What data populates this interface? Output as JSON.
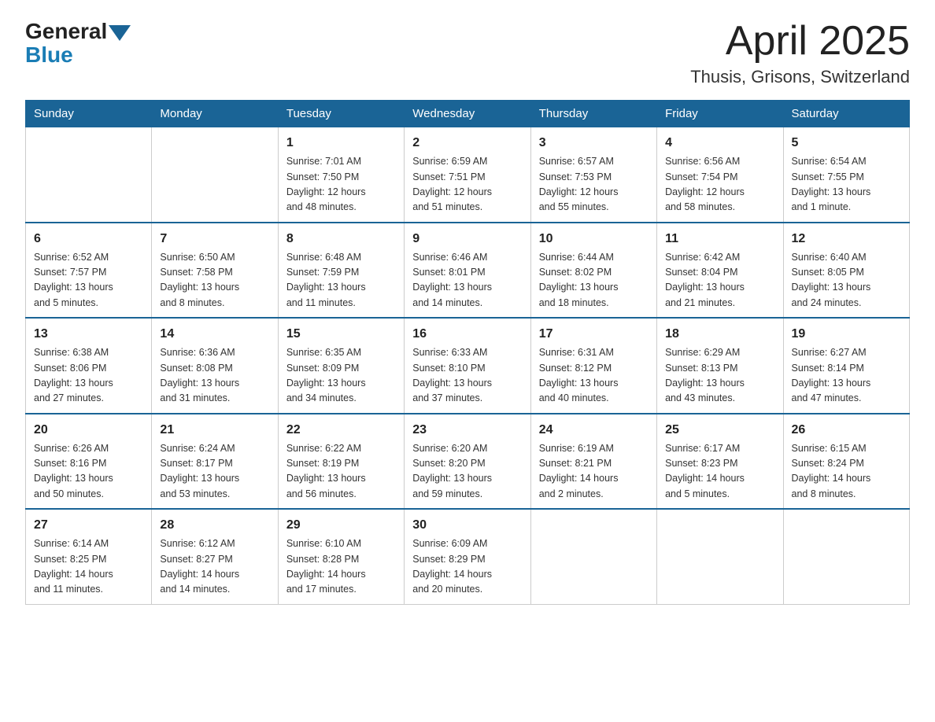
{
  "header": {
    "logo_general": "General",
    "logo_blue": "Blue",
    "month_title": "April 2025",
    "location": "Thusis, Grisons, Switzerland"
  },
  "weekdays": [
    "Sunday",
    "Monday",
    "Tuesday",
    "Wednesday",
    "Thursday",
    "Friday",
    "Saturday"
  ],
  "weeks": [
    [
      {
        "day": "",
        "info": ""
      },
      {
        "day": "",
        "info": ""
      },
      {
        "day": "1",
        "info": "Sunrise: 7:01 AM\nSunset: 7:50 PM\nDaylight: 12 hours\nand 48 minutes."
      },
      {
        "day": "2",
        "info": "Sunrise: 6:59 AM\nSunset: 7:51 PM\nDaylight: 12 hours\nand 51 minutes."
      },
      {
        "day": "3",
        "info": "Sunrise: 6:57 AM\nSunset: 7:53 PM\nDaylight: 12 hours\nand 55 minutes."
      },
      {
        "day": "4",
        "info": "Sunrise: 6:56 AM\nSunset: 7:54 PM\nDaylight: 12 hours\nand 58 minutes."
      },
      {
        "day": "5",
        "info": "Sunrise: 6:54 AM\nSunset: 7:55 PM\nDaylight: 13 hours\nand 1 minute."
      }
    ],
    [
      {
        "day": "6",
        "info": "Sunrise: 6:52 AM\nSunset: 7:57 PM\nDaylight: 13 hours\nand 5 minutes."
      },
      {
        "day": "7",
        "info": "Sunrise: 6:50 AM\nSunset: 7:58 PM\nDaylight: 13 hours\nand 8 minutes."
      },
      {
        "day": "8",
        "info": "Sunrise: 6:48 AM\nSunset: 7:59 PM\nDaylight: 13 hours\nand 11 minutes."
      },
      {
        "day": "9",
        "info": "Sunrise: 6:46 AM\nSunset: 8:01 PM\nDaylight: 13 hours\nand 14 minutes."
      },
      {
        "day": "10",
        "info": "Sunrise: 6:44 AM\nSunset: 8:02 PM\nDaylight: 13 hours\nand 18 minutes."
      },
      {
        "day": "11",
        "info": "Sunrise: 6:42 AM\nSunset: 8:04 PM\nDaylight: 13 hours\nand 21 minutes."
      },
      {
        "day": "12",
        "info": "Sunrise: 6:40 AM\nSunset: 8:05 PM\nDaylight: 13 hours\nand 24 minutes."
      }
    ],
    [
      {
        "day": "13",
        "info": "Sunrise: 6:38 AM\nSunset: 8:06 PM\nDaylight: 13 hours\nand 27 minutes."
      },
      {
        "day": "14",
        "info": "Sunrise: 6:36 AM\nSunset: 8:08 PM\nDaylight: 13 hours\nand 31 minutes."
      },
      {
        "day": "15",
        "info": "Sunrise: 6:35 AM\nSunset: 8:09 PM\nDaylight: 13 hours\nand 34 minutes."
      },
      {
        "day": "16",
        "info": "Sunrise: 6:33 AM\nSunset: 8:10 PM\nDaylight: 13 hours\nand 37 minutes."
      },
      {
        "day": "17",
        "info": "Sunrise: 6:31 AM\nSunset: 8:12 PM\nDaylight: 13 hours\nand 40 minutes."
      },
      {
        "day": "18",
        "info": "Sunrise: 6:29 AM\nSunset: 8:13 PM\nDaylight: 13 hours\nand 43 minutes."
      },
      {
        "day": "19",
        "info": "Sunrise: 6:27 AM\nSunset: 8:14 PM\nDaylight: 13 hours\nand 47 minutes."
      }
    ],
    [
      {
        "day": "20",
        "info": "Sunrise: 6:26 AM\nSunset: 8:16 PM\nDaylight: 13 hours\nand 50 minutes."
      },
      {
        "day": "21",
        "info": "Sunrise: 6:24 AM\nSunset: 8:17 PM\nDaylight: 13 hours\nand 53 minutes."
      },
      {
        "day": "22",
        "info": "Sunrise: 6:22 AM\nSunset: 8:19 PM\nDaylight: 13 hours\nand 56 minutes."
      },
      {
        "day": "23",
        "info": "Sunrise: 6:20 AM\nSunset: 8:20 PM\nDaylight: 13 hours\nand 59 minutes."
      },
      {
        "day": "24",
        "info": "Sunrise: 6:19 AM\nSunset: 8:21 PM\nDaylight: 14 hours\nand 2 minutes."
      },
      {
        "day": "25",
        "info": "Sunrise: 6:17 AM\nSunset: 8:23 PM\nDaylight: 14 hours\nand 5 minutes."
      },
      {
        "day": "26",
        "info": "Sunrise: 6:15 AM\nSunset: 8:24 PM\nDaylight: 14 hours\nand 8 minutes."
      }
    ],
    [
      {
        "day": "27",
        "info": "Sunrise: 6:14 AM\nSunset: 8:25 PM\nDaylight: 14 hours\nand 11 minutes."
      },
      {
        "day": "28",
        "info": "Sunrise: 6:12 AM\nSunset: 8:27 PM\nDaylight: 14 hours\nand 14 minutes."
      },
      {
        "day": "29",
        "info": "Sunrise: 6:10 AM\nSunset: 8:28 PM\nDaylight: 14 hours\nand 17 minutes."
      },
      {
        "day": "30",
        "info": "Sunrise: 6:09 AM\nSunset: 8:29 PM\nDaylight: 14 hours\nand 20 minutes."
      },
      {
        "day": "",
        "info": ""
      },
      {
        "day": "",
        "info": ""
      },
      {
        "day": "",
        "info": ""
      }
    ]
  ]
}
